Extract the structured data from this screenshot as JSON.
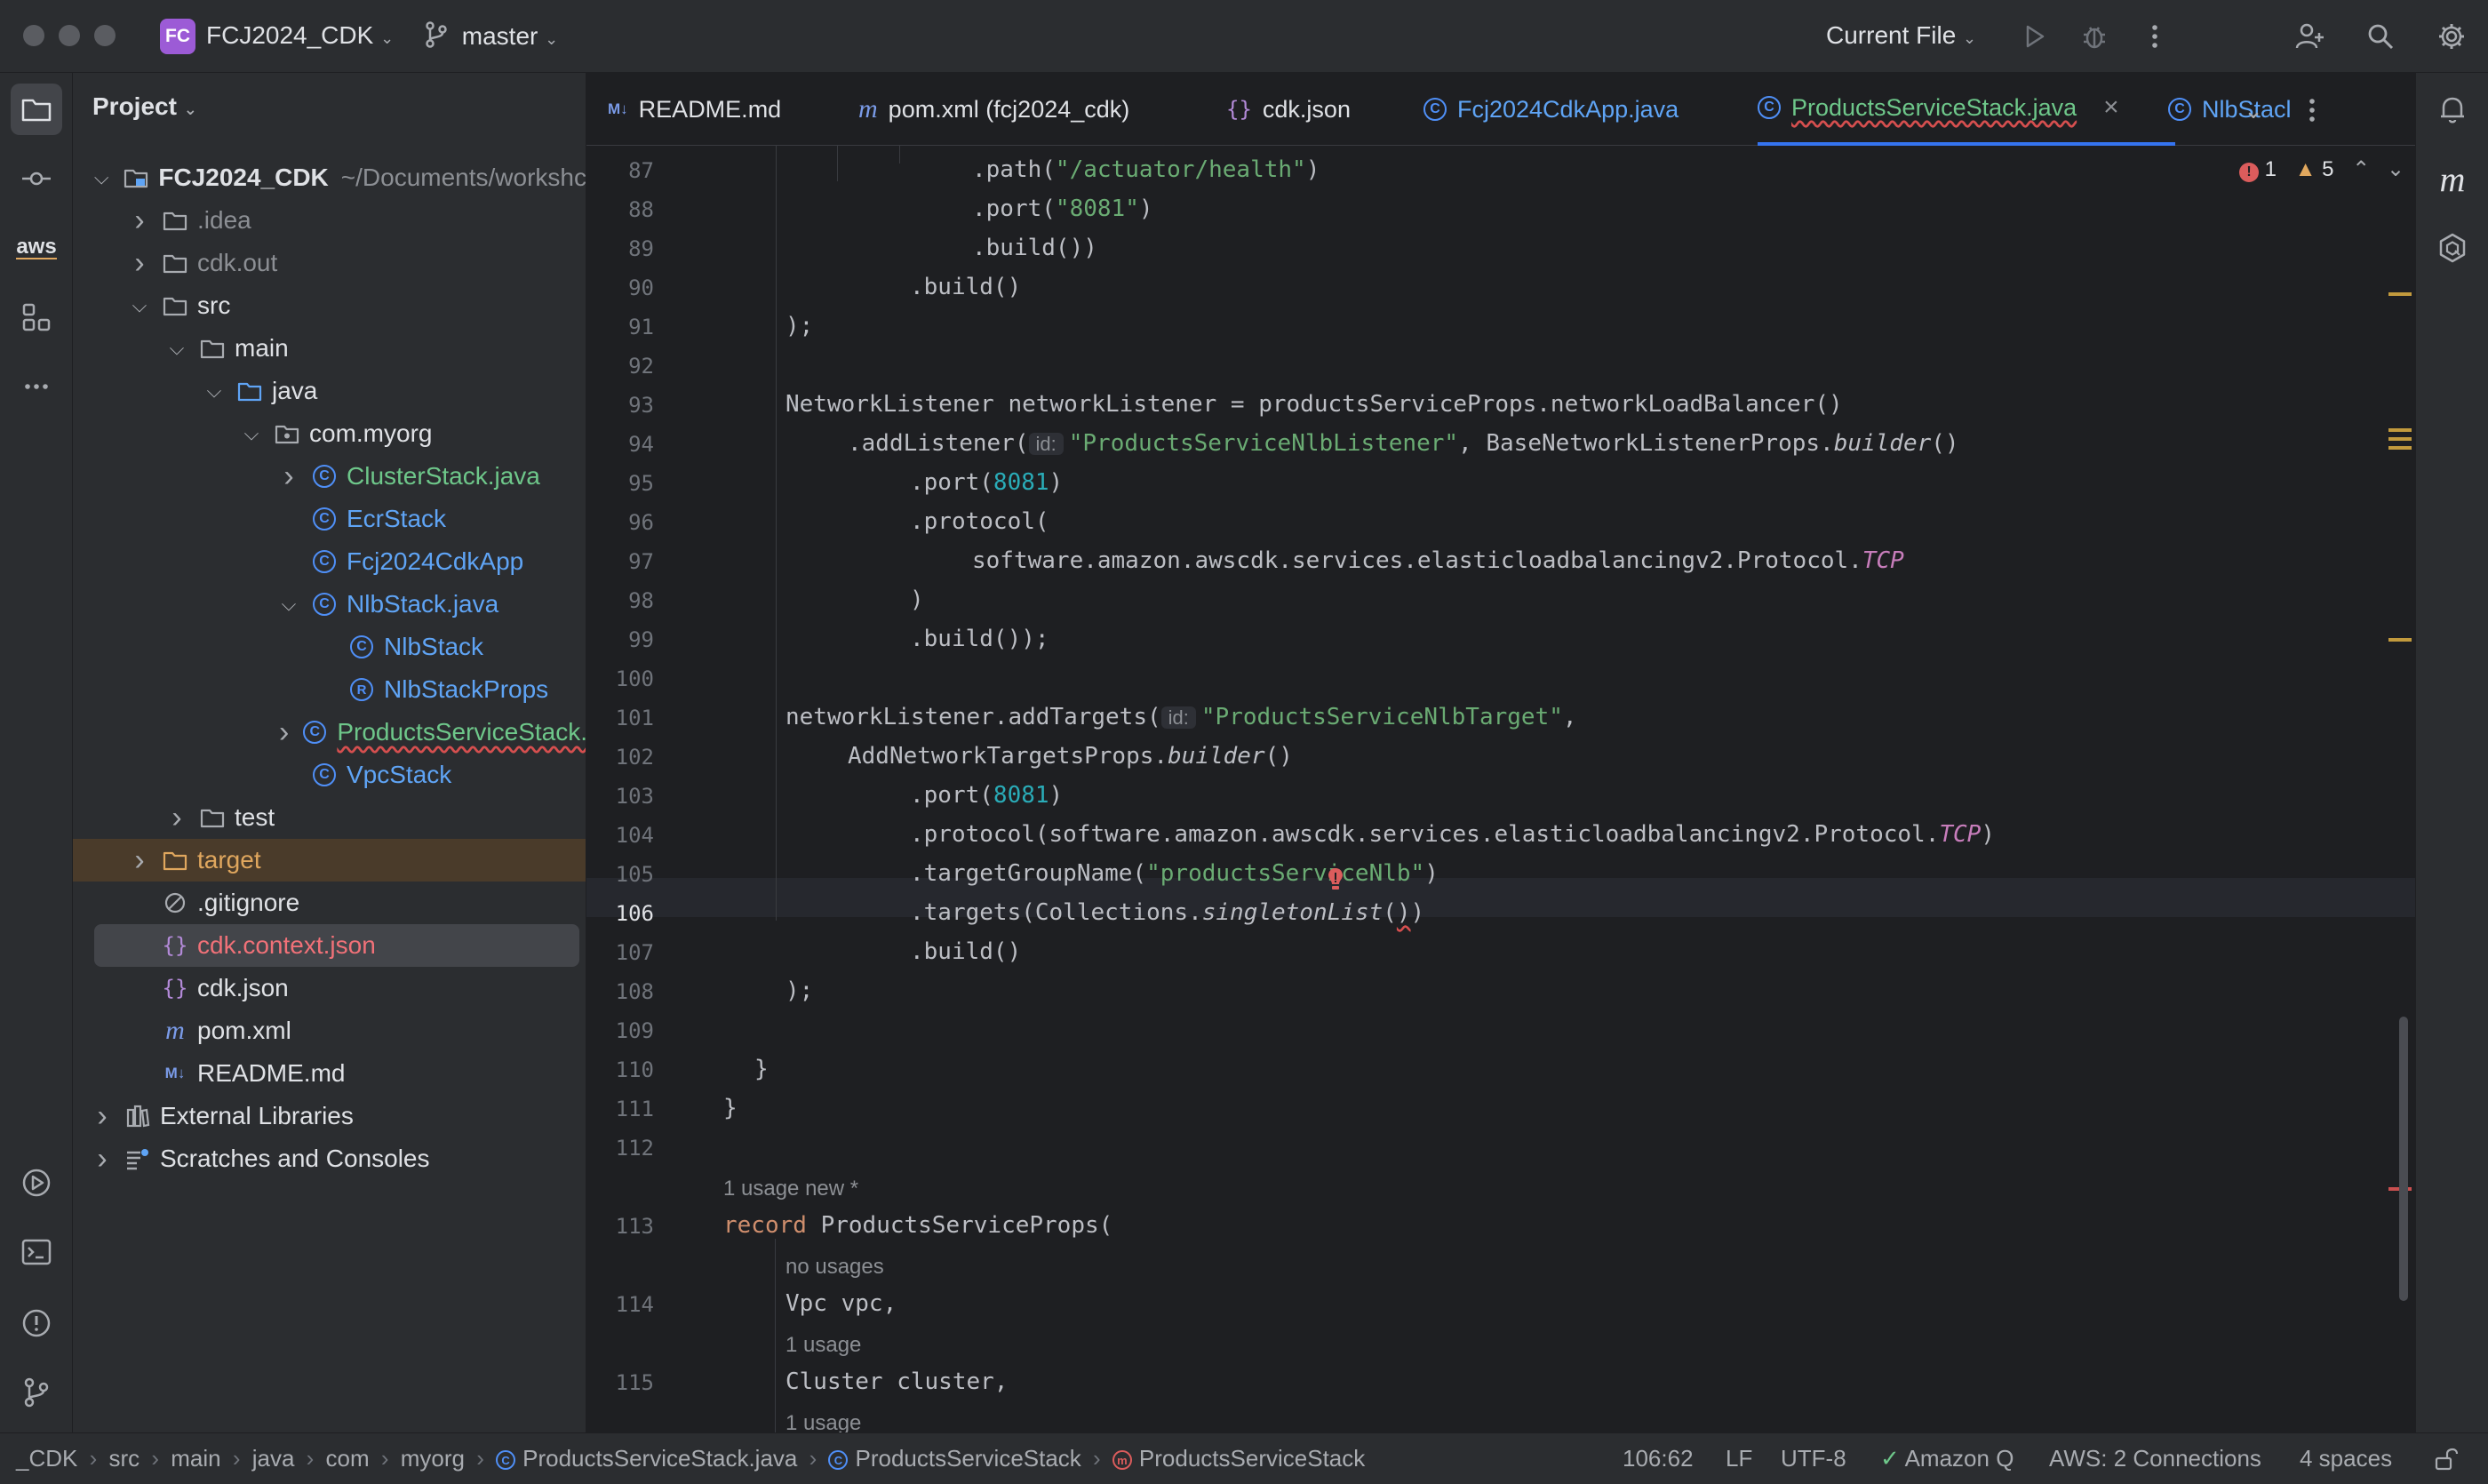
{
  "titlebar": {
    "project_badge": "FC",
    "project_name": "FCJ2024_CDK",
    "branch": "master",
    "run_config": "Current File"
  },
  "toolstrip": {
    "left_items": [
      "project-icon",
      "commit-icon",
      "aws-icon",
      "structure-icon",
      "more-icon"
    ],
    "aws_label": "aws",
    "bottom_items": [
      "run-icon",
      "terminal-icon",
      "problems-icon",
      "git-icon"
    ]
  },
  "project_panel": {
    "title": "Project",
    "tree": [
      {
        "label": "FCJ2024_CDK",
        "suffix": "~/Documents/workshc",
        "depth": 0,
        "arrow": "v",
        "icon": "folder-module",
        "bold": true
      },
      {
        "label": ".idea",
        "depth": 1,
        "arrow": ">",
        "icon": "folder",
        "color": "grey"
      },
      {
        "label": "cdk.out",
        "depth": 1,
        "arrow": ">",
        "icon": "folder",
        "color": "grey"
      },
      {
        "label": "src",
        "depth": 1,
        "arrow": "v",
        "icon": "folder"
      },
      {
        "label": "main",
        "depth": 2,
        "arrow": "v",
        "icon": "folder"
      },
      {
        "label": "java",
        "depth": 3,
        "arrow": "v",
        "icon": "folder-src"
      },
      {
        "label": "com.myorg",
        "depth": 4,
        "arrow": "v",
        "icon": "package"
      },
      {
        "label": "ClusterStack.java",
        "depth": 5,
        "arrow": ">",
        "icon": "class",
        "color": "green"
      },
      {
        "label": "EcrStack",
        "depth": 5,
        "arrow": "",
        "icon": "class",
        "color": "blue"
      },
      {
        "label": "Fcj2024CdkApp",
        "depth": 5,
        "arrow": "",
        "icon": "class",
        "color": "blue"
      },
      {
        "label": "NlbStack.java",
        "depth": 5,
        "arrow": "v",
        "icon": "class",
        "color": "blue"
      },
      {
        "label": "NlbStack",
        "depth": 6,
        "arrow": "",
        "icon": "class",
        "color": "blue"
      },
      {
        "label": "NlbStackProps",
        "depth": 6,
        "arrow": "",
        "icon": "record",
        "color": "blue"
      },
      {
        "label": "ProductsServiceStack.j",
        "depth": 5,
        "arrow": ">",
        "icon": "class",
        "color": "green",
        "wavy": true
      },
      {
        "label": "VpcStack",
        "depth": 5,
        "arrow": "",
        "icon": "class",
        "color": "blue"
      },
      {
        "label": "test",
        "depth": 2,
        "arrow": ">",
        "icon": "folder"
      },
      {
        "label": "target",
        "depth": 1,
        "arrow": ">",
        "icon": "folder-orange",
        "color": "orange",
        "highlight": "orange"
      },
      {
        "label": ".gitignore",
        "depth": 1,
        "arrow": "",
        "icon": "ignore"
      },
      {
        "label": "cdk.context.json",
        "depth": 1,
        "arrow": "",
        "icon": "json",
        "color": "red",
        "highlight": "selected"
      },
      {
        "label": "cdk.json",
        "depth": 1,
        "arrow": "",
        "icon": "json"
      },
      {
        "label": "pom.xml",
        "depth": 1,
        "arrow": "",
        "icon": "maven"
      },
      {
        "label": "README.md",
        "depth": 1,
        "arrow": "",
        "icon": "markdown"
      },
      {
        "label": "External Libraries",
        "depth": 0,
        "arrow": ">",
        "icon": "library"
      },
      {
        "label": "Scratches and Consoles",
        "depth": 0,
        "arrow": ">",
        "icon": "scratches"
      }
    ]
  },
  "tabs": [
    {
      "label": "README.md",
      "icon": "markdown"
    },
    {
      "label": "pom.xml (fcj2024_cdk)",
      "icon": "maven"
    },
    {
      "label": "cdk.json",
      "icon": "json"
    },
    {
      "label": "Fcj2024CdkApp.java",
      "icon": "class"
    },
    {
      "label": "ProductsServiceStack.java",
      "icon": "class",
      "active": true
    },
    {
      "label": "NlbStacl",
      "icon": "class"
    }
  ],
  "inspections": {
    "errors": "1",
    "warnings": "5"
  },
  "editor": {
    "lines": [
      {
        "n": "87",
        "indent": 8,
        "html": ".path(<span class=\"str\">\"/actuator/health\"</span>)"
      },
      {
        "n": "88",
        "indent": 8,
        "html": ".port(<span class=\"str\">\"8081\"</span>)"
      },
      {
        "n": "89",
        "indent": 8,
        "html": ".build())"
      },
      {
        "n": "90",
        "indent": 6,
        "html": ".build()"
      },
      {
        "n": "91",
        "indent": 2,
        "html": ");"
      },
      {
        "n": "92",
        "indent": 0,
        "html": ""
      },
      {
        "n": "93",
        "indent": 2,
        "html": "NetworkListener networkListener = productsServiceProps.networkLoadBalancer()"
      },
      {
        "n": "94",
        "indent": 4,
        "html": ".addListener(<span class=\"inlay\">id:</span><span class=\"str\">\"ProductsServiceNlbListener\"</span>, BaseNetworkListenerProps.<span class=\"it\">builder</span>()"
      },
      {
        "n": "95",
        "indent": 6,
        "html": ".port(<span class=\"num\">8081</span>)"
      },
      {
        "n": "96",
        "indent": 6,
        "html": ".protocol("
      },
      {
        "n": "97",
        "indent": 8,
        "html": "software.amazon.awscdk.services.elasticloadbalancingv2.Protocol.<span class=\"cst\">TCP</span>"
      },
      {
        "n": "98",
        "indent": 6,
        "html": ")"
      },
      {
        "n": "99",
        "indent": 6,
        "html": ".build());"
      },
      {
        "n": "100",
        "indent": 0,
        "html": ""
      },
      {
        "n": "101",
        "indent": 2,
        "html": "networkListener.addTargets(<span class=\"inlay\">id:</span><span class=\"str\">\"ProductsServiceNlbTarget\"</span>,"
      },
      {
        "n": "102",
        "indent": 4,
        "html": "AddNetworkTargetsProps.<span class=\"it\">builder</span>()"
      },
      {
        "n": "103",
        "indent": 6,
        "html": ".port(<span class=\"num\">8081</span>)"
      },
      {
        "n": "104",
        "indent": 6,
        "html": ".protocol(software.amazon.awscdk.services.elasticloadbalancingv2.Protocol.<span class=\"cst\">TCP</span>)"
      },
      {
        "n": "105",
        "indent": 6,
        "html": ".targetGroupName(<span class=\"str\">\"productsServiceNlb\"</span>)"
      },
      {
        "n": "106",
        "indent": 6,
        "html": ".targets(Collections.<span class=\"it\">singletonList</span>(<span class=\"wavy\">)</span>)",
        "current": true
      },
      {
        "n": "107",
        "indent": 6,
        "html": ".build()"
      },
      {
        "n": "108",
        "indent": 2,
        "html": ");"
      },
      {
        "n": "109",
        "indent": 0,
        "html": ""
      },
      {
        "n": "110",
        "indent": 1,
        "html": "}"
      },
      {
        "n": "111",
        "indent": 0,
        "html": "}"
      },
      {
        "n": "112",
        "indent": 0,
        "html": ""
      },
      {
        "hint": "1 usage   new *",
        "indent": 0
      },
      {
        "n": "113",
        "indent": 0,
        "html": "<span class=\"kw\">record</span> ProductsServiceProps("
      },
      {
        "hint": "no usages",
        "indent": 2
      },
      {
        "n": "114",
        "indent": 2,
        "html": "Vpc vpc,"
      },
      {
        "hint": "1 usage",
        "indent": 2
      },
      {
        "n": "115",
        "indent": 2,
        "html": "Cluster cluster,"
      },
      {
        "hint": "1 usage",
        "indent": 2
      }
    ]
  },
  "statusbar": {
    "breadcrumb": [
      "_CDK",
      "src",
      "main",
      "java",
      "com",
      "myorg",
      "ProductsServiceStack.java",
      "ProductsServiceStack",
      "ProductsServiceStack"
    ],
    "position": "106:62",
    "line_sep": "LF",
    "encoding": "UTF-8",
    "amazon_q": "Amazon Q",
    "aws": "AWS: 2 Connections",
    "indent": "4 spaces"
  }
}
